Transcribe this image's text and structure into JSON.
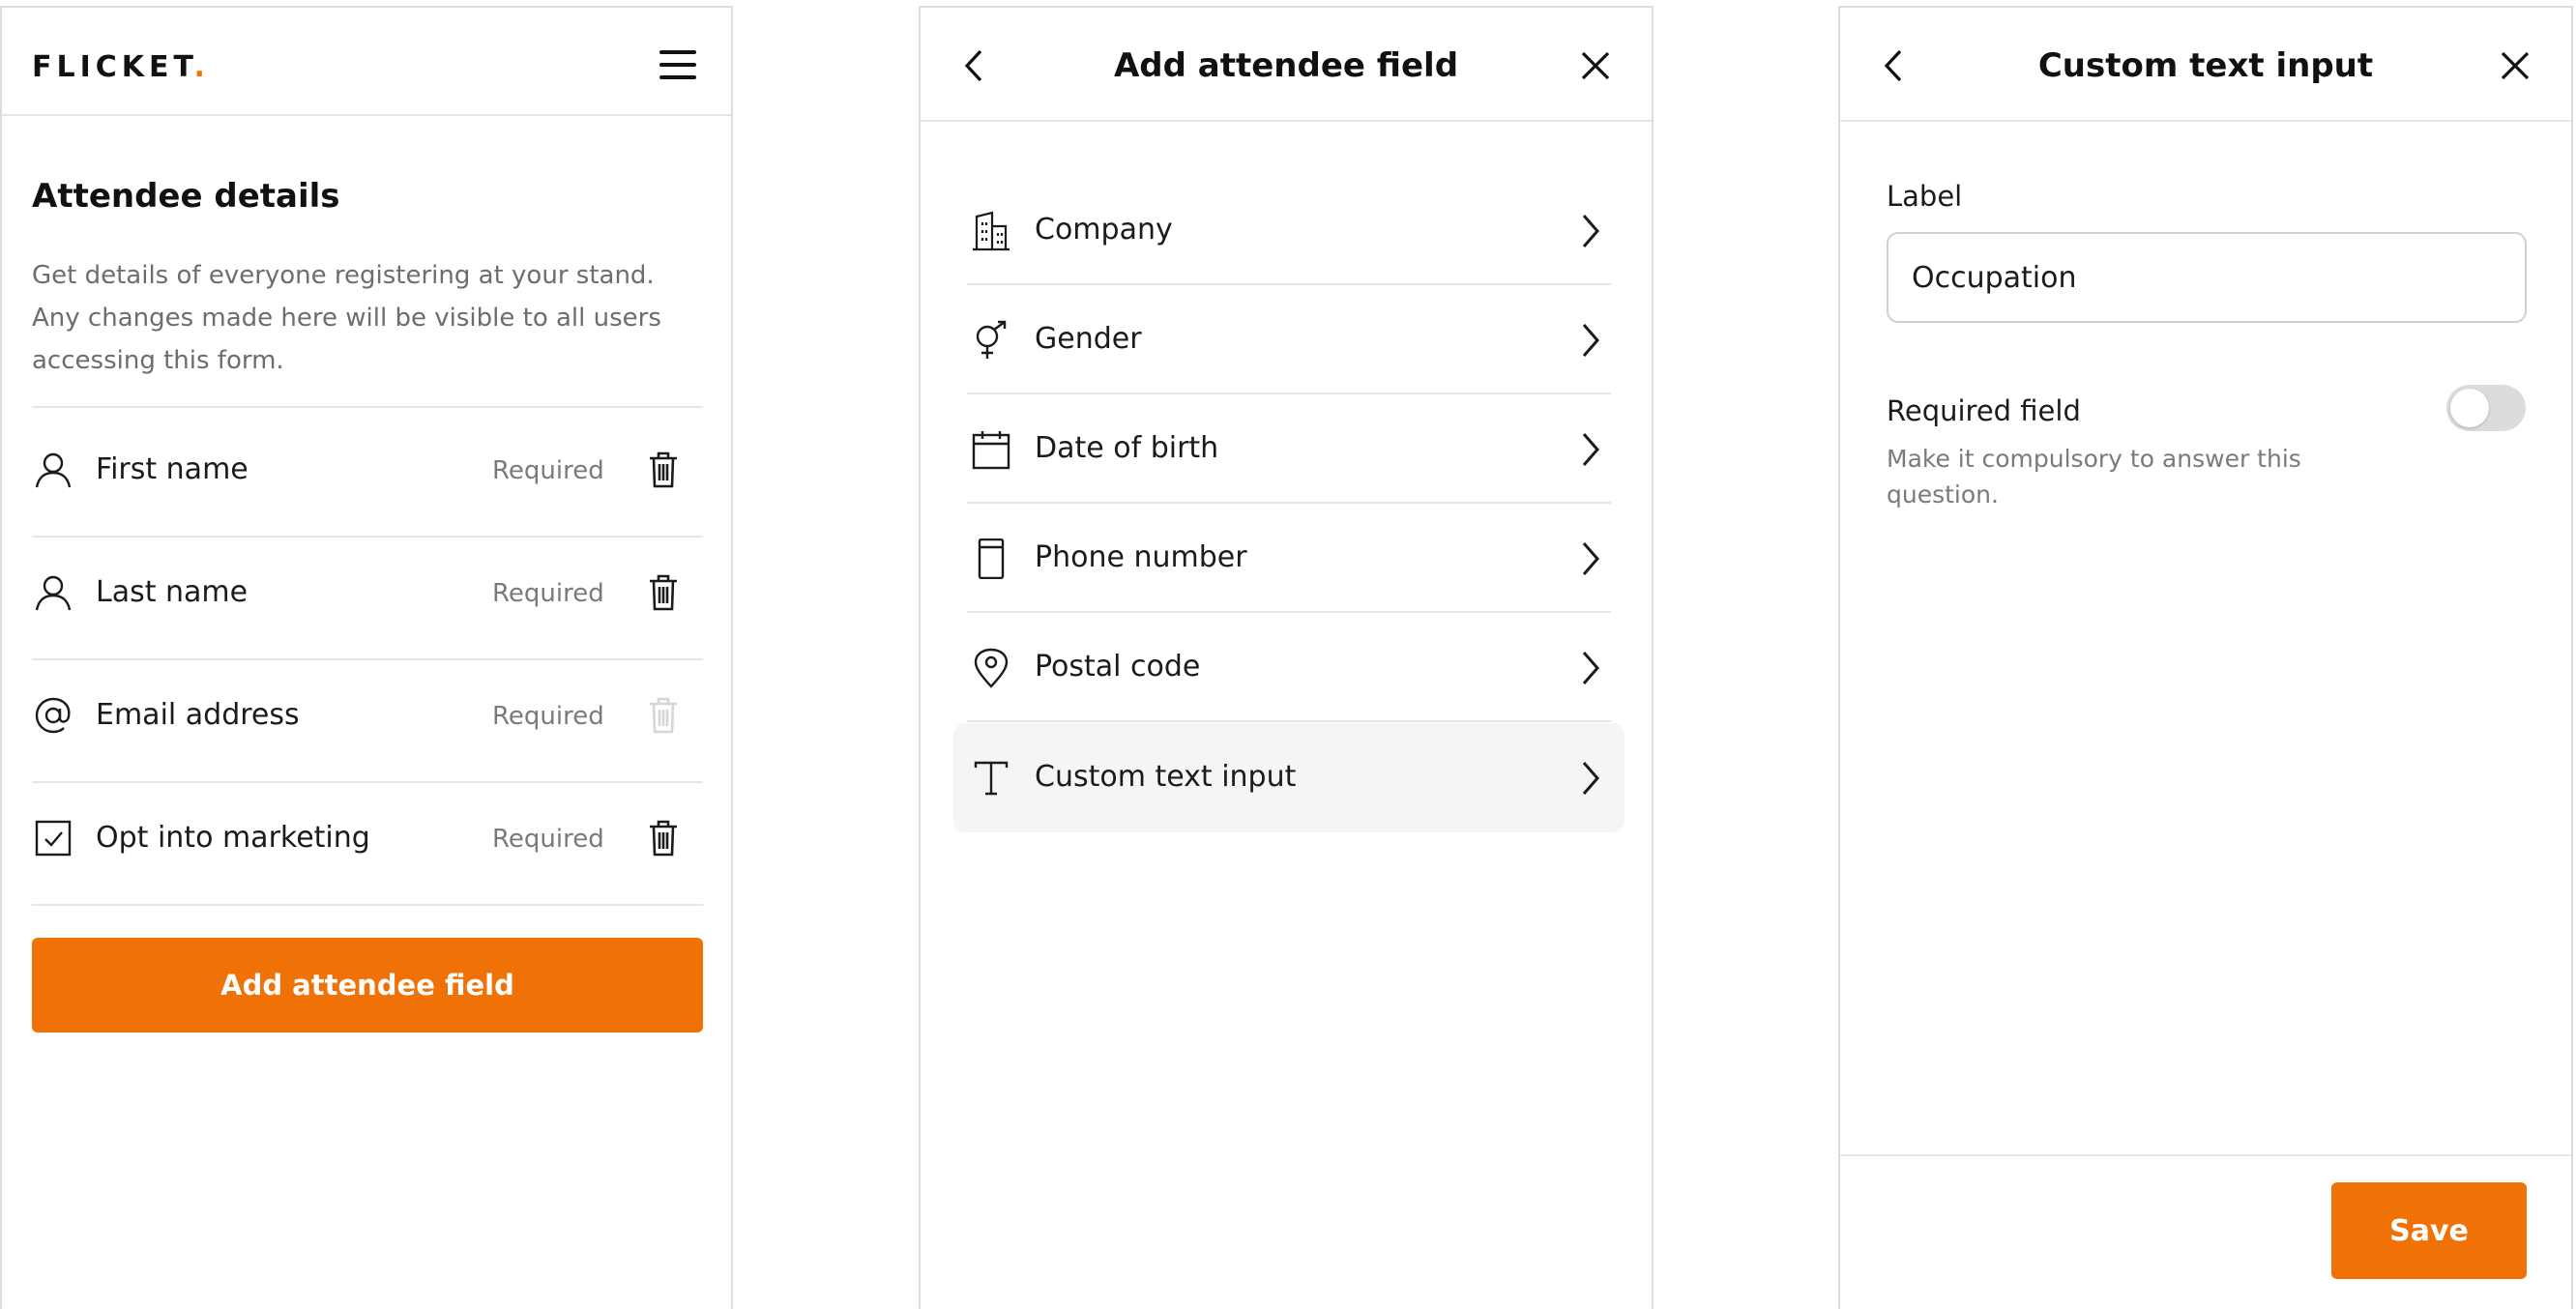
{
  "brand": {
    "logo_text": "FLICKET",
    "logo_dot": ".",
    "accent_color": "#f07206"
  },
  "attendee_details": {
    "title": "Attendee details",
    "description": "Get details of everyone registering at your stand. Any changes made here will be visible to all users accessing this form.",
    "fields": [
      {
        "icon": "person-icon",
        "label": "First name",
        "status": "Required",
        "deletable": true
      },
      {
        "icon": "person-icon",
        "label": "Last name",
        "status": "Required",
        "deletable": true
      },
      {
        "icon": "at-icon",
        "label": "Email address",
        "status": "Required",
        "deletable": false
      },
      {
        "icon": "checkbox-icon",
        "label": "Opt into marketing",
        "status": "Required",
        "deletable": true
      }
    ],
    "add_button_label": "Add attendee field"
  },
  "add_field_panel": {
    "title": "Add attendee field",
    "options": [
      {
        "icon": "building-icon",
        "label": "Company"
      },
      {
        "icon": "gender-icon",
        "label": "Gender"
      },
      {
        "icon": "calendar-icon",
        "label": "Date of birth"
      },
      {
        "icon": "phone-icon",
        "label": "Phone number"
      },
      {
        "icon": "location-pin-icon",
        "label": "Postal code"
      },
      {
        "icon": "text-icon",
        "label": "Custom text input",
        "highlighted": true
      }
    ]
  },
  "custom_text_panel": {
    "title": "Custom text input",
    "label_caption": "Label",
    "label_value": "Occupation",
    "required_title": "Required field",
    "required_desc": "Make it compulsory to answer this question.",
    "required_enabled": false,
    "save_label": "Save"
  }
}
